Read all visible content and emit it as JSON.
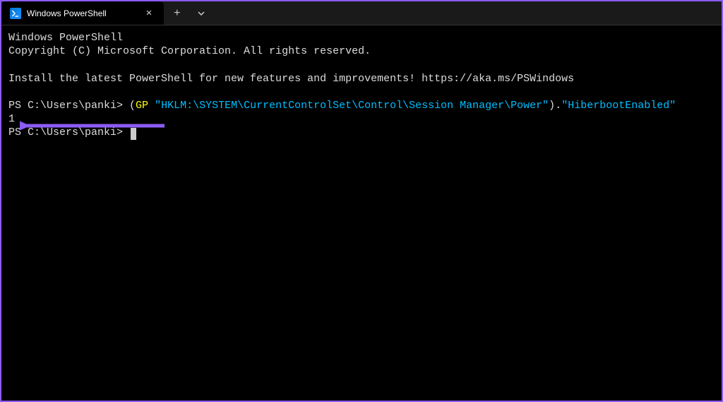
{
  "tab": {
    "title": "Windows PowerShell"
  },
  "terminal": {
    "header": {
      "line1": "Windows PowerShell",
      "line2": "Copyright (C) Microsoft Corporation. All rights reserved."
    },
    "banner": "Install the latest PowerShell for new features and improvements! https://aka.ms/PSWindows",
    "prompt1": {
      "path": "PS C:\\Users\\panki> ",
      "cmd_open": "(",
      "cmd_gp": "GP",
      "cmd_space": " ",
      "cmd_quoted": "\"HKLM:\\SYSTEM\\CurrentControlSet\\Control\\Session Manager\\Power\"",
      "cmd_close": ")",
      "cmd_dot": ".",
      "cmd_prop": "\"HiberbootEnabled\""
    },
    "output": "1",
    "prompt2": {
      "path": "PS C:\\Users\\panki> "
    }
  },
  "colors": {
    "accent_purple": "#8b5cf6",
    "syntax_yellow": "#ffff00",
    "syntax_cyan": "#00bfff"
  }
}
